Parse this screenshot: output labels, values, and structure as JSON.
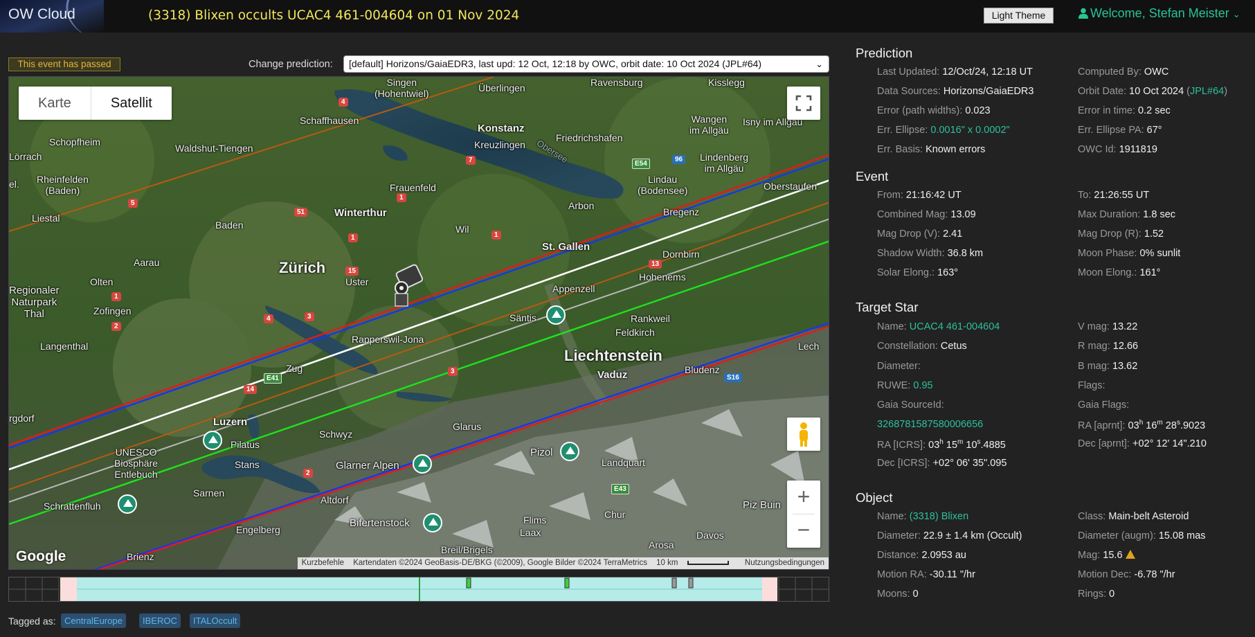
{
  "header": {
    "logo": "OW Cloud",
    "event_title": "(3318) Blixen occults UCAC4 461-004604 on 01 Nov 2024",
    "theme_button": "Light Theme",
    "welcome": "Welcome, Stefan Meister",
    "colors": {
      "title": "#f2e75a",
      "accent": "#27c496"
    }
  },
  "status": {
    "passed": "This event has passed"
  },
  "prediction_selector": {
    "label": "Change prediction:",
    "selected": "[default] Horizons/GaiaEDR3, last upd: 12 Oct, 12:18 by OWC, orbit date: 10 Oct 2024 (JPL#64)"
  },
  "map": {
    "type_buttons": [
      "Karte",
      "Satellit"
    ],
    "active_type": "Satellit",
    "zoom_in": "+",
    "zoom_out": "−",
    "google": "Google",
    "shortcuts": "Kurzbefehle",
    "attribution": "Kartendaten ©2024 GeoBasis-DE/BKG (©2009), Google Bilder ©2024 TerraMetrics",
    "scale": "10 km",
    "terms": "Nutzungsbedingungen",
    "places": {
      "singen": "Singen\n(Hohentwiel)",
      "uberlingen": "Überlingen",
      "ravensburg": "Ravensburg",
      "kisslegg": "Kisslegg",
      "schaffhausen": "Schaffhausen",
      "konstanz": "Konstanz",
      "kreuzlingen": "Kreuzlingen",
      "friedrichshafen": "Friedrichshafen",
      "wangen": "Wangen\nim Allgäu",
      "isny": "Isny im Allgäu",
      "schopfheim": "Schopfheim",
      "waldshut": "Waldshut-Tiengen",
      "lorrach": "Lörrach",
      "rheinfelden": "Rheinfelden\n(Baden)",
      "frauenfeld": "Frauenfeld",
      "oberseebodensee": "Obersee",
      "lindau": "Lindau\n(Bodensee)",
      "lindenberg": "Lindenberg\nim Allgäu",
      "oberstaufen": "Oberstaufen",
      "liestal": "Liestal",
      "winterthur": "Winterthur",
      "arbon": "Arbon",
      "bregenz": "Bregenz",
      "baden": "Baden",
      "wil": "Wil",
      "aarau": "Aarau",
      "zurich": "Zürich",
      "stgallen": "St. Gallen",
      "dornbirn": "Dornbirn",
      "uster": "Uster",
      "olten": "Olten",
      "regionaler": "Regionaler\nNaturpark\nThal",
      "appenzell": "Appenzell",
      "hohenems": "Hohenems",
      "zofingen": "Zofingen",
      "santis": "Säntis",
      "rankweil": "Rankweil",
      "feldkirch": "Feldkirch",
      "langenthal": "Langenthal",
      "rapperswil": "Rapperswil-Jona",
      "liechtenstein": "Liechtenstein",
      "vaduz": "Vaduz",
      "bludenz": "Bludenz",
      "lech": "Lech",
      "zug": "Zug",
      "luzern": "Luzern",
      "pilatus": "Pilatus",
      "schwyz": "Schwyz",
      "glarus": "Glarus",
      "unesco": "UNESCO\nBiosphäre\nEntlebuch",
      "stans": "Stans",
      "glarneralpen": "Glarner Alpen",
      "pizol": "Pizol",
      "landquart": "Landquart",
      "sarnen": "Sarnen",
      "schrattenfluh": "Schrattenfluh",
      "altdorf": "Altdorf",
      "chur": "Chur",
      "pizbuin": "Piz Buin",
      "engelberg": "Engelberg",
      "bifertenstock": "Bifertenstock",
      "flims": "Flims",
      "laax": "Laax",
      "davos": "Davos",
      "brienz": "Brienz",
      "breilbrigels": "Breil/Brigels",
      "arosa": "Arosa",
      "burgdorf": "rgdorf",
      "jels": "el."
    },
    "road_badges": [
      "4",
      "7",
      "1",
      "51",
      "1",
      "1",
      "15",
      "13",
      "1",
      "2",
      "4",
      "3",
      "14",
      "3",
      "2",
      "5"
    ],
    "green_badges": [
      "E54",
      "E41",
      "E43"
    ],
    "blue_badges": [
      "96",
      "S16"
    ]
  },
  "tags": {
    "label": "Tagged as:",
    "items": [
      "CentralEurope",
      "IBEROC",
      "ITALOccult"
    ]
  },
  "prediction": {
    "title": "Prediction",
    "last_updated": {
      "label": "Last Updated:",
      "value": "12/Oct/24, 12:18 UT"
    },
    "computed_by": {
      "label": "Computed By:",
      "value": "OWC"
    },
    "data_sources": {
      "label": "Data Sources:",
      "value": "Horizons/GaiaEDR3"
    },
    "orbit_date": {
      "label": "Orbit Date:",
      "value": "10 Oct 2024",
      "jpl_prefix": "(",
      "jpl": "JPL#64",
      "jpl_suffix": ")"
    },
    "error_widths": {
      "label": "Error (path widths):",
      "value": "0.023"
    },
    "error_time": {
      "label": "Error in time:",
      "value": "0.2 sec"
    },
    "err_ellipse": {
      "label": "Err. Ellipse:",
      "value": "0.0016\" x 0.0002\""
    },
    "err_ellipse_pa": {
      "label": "Err. Ellipse PA:",
      "value": "67°"
    },
    "err_basis": {
      "label": "Err. Basis:",
      "value": "Known errors"
    },
    "owc_id": {
      "label": "OWC Id:",
      "value": "1911819"
    }
  },
  "event": {
    "title": "Event",
    "from": {
      "label": "From:",
      "value": "21:16:42 UT"
    },
    "to": {
      "label": "To:",
      "value": "21:26:55 UT"
    },
    "combined_mag": {
      "label": "Combined Mag:",
      "value": "13.09"
    },
    "max_duration": {
      "label": "Max Duration:",
      "value": "1.8 sec"
    },
    "mag_drop_v": {
      "label": "Mag Drop (V):",
      "value": "2.41"
    },
    "mag_drop_r": {
      "label": "Mag Drop (R):",
      "value": "1.52"
    },
    "shadow_width": {
      "label": "Shadow Width:",
      "value": "36.8 km"
    },
    "moon_phase": {
      "label": "Moon Phase:",
      "value": "0% sunlit"
    },
    "solar_elong": {
      "label": "Solar Elong.:",
      "value": "163°"
    },
    "moon_elong": {
      "label": "Moon Elong.:",
      "value": "161°"
    }
  },
  "target_star": {
    "title": "Target Star",
    "name": {
      "label": "Name:",
      "value": "UCAC4 461-004604"
    },
    "v_mag": {
      "label": "V mag:",
      "value": "13.22"
    },
    "constellation": {
      "label": "Constellation:",
      "value": "Cetus"
    },
    "r_mag": {
      "label": "R mag:",
      "value": "12.66"
    },
    "diameter": {
      "label": "Diameter:",
      "value": ""
    },
    "b_mag": {
      "label": "B mag:",
      "value": "13.62"
    },
    "ruwe": {
      "label": "RUWE:",
      "value": "0.95"
    },
    "flags": {
      "label": "Flags:",
      "value": ""
    },
    "gaia_source_id": {
      "label": "Gaia SourceId:",
      "value": "3268781587580006656"
    },
    "gaia_flags": {
      "label": "Gaia Flags:",
      "value": ""
    },
    "ra_icrs": {
      "label": "RA [ICRS]:",
      "h": "03",
      "m": "15",
      "s": "10",
      "frac": ".4885"
    },
    "ra_aprnt": {
      "label": "RA [aprnt]:",
      "h": "03",
      "m": "16",
      "s": "28",
      "frac": ".9023"
    },
    "dec_icrs": {
      "label": "Dec [ICRS]:",
      "d": "+02",
      "m": "06",
      "s": "35",
      "frac": ".095"
    },
    "dec_aprnt": {
      "label": "Dec [aprnt]:",
      "d": "+02",
      "m": "12",
      "s": "14",
      "frac": ".210"
    }
  },
  "object": {
    "title": "Object",
    "name": {
      "label": "Name:",
      "value": "(3318) Blixen"
    },
    "class": {
      "label": "Class:",
      "value": "Main-belt Asteroid"
    },
    "diameter": {
      "label": "Diameter:",
      "value": "22.9 ± 1.4 km",
      "note": "(Occult)"
    },
    "diameter_augm": {
      "label": "Diameter (augm):",
      "value": "15.08 mas"
    },
    "distance": {
      "label": "Distance:",
      "value": "2.0953 au"
    },
    "mag": {
      "label": "Mag:",
      "value": "15.6"
    },
    "motion_ra": {
      "label": "Motion RA:",
      "value": "-30.11 \"/hr"
    },
    "motion_dec": {
      "label": "Motion Dec:",
      "value": "-6.78 \"/hr"
    },
    "moons": {
      "label": "Moons:",
      "value": "0"
    },
    "rings": {
      "label": "Rings:",
      "value": "0"
    }
  }
}
